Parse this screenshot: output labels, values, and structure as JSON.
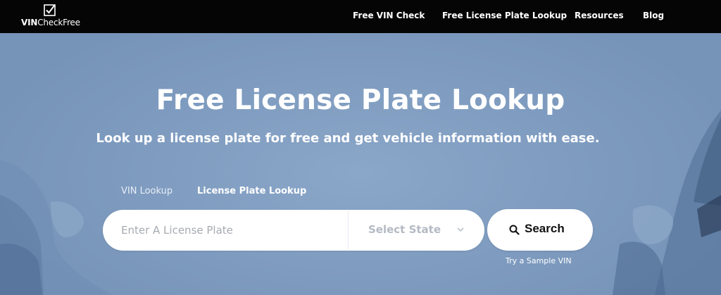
{
  "navbar": {
    "logo": {
      "bold": "VIN",
      "regular": "CheckFree",
      "icon": "checkbox-icon"
    },
    "items": [
      {
        "label": "Free VIN Check"
      },
      {
        "label": "Free License Plate Lookup"
      },
      {
        "label": "Resources"
      },
      {
        "label": "Blog"
      }
    ]
  },
  "hero": {
    "title": "Free License Plate Lookup",
    "subtitle": "Look up a license plate for free and get vehicle information with ease.",
    "tabs": [
      {
        "label": "VIN Lookup",
        "active": false
      },
      {
        "label": "License Plate Lookup",
        "active": true
      }
    ],
    "search": {
      "placeholder": "Enter A License Plate",
      "value": "",
      "state_select": {
        "selected": "Select State",
        "icon": "chevron-down-icon"
      },
      "button": {
        "label": "Search",
        "icon": "search-icon"
      }
    },
    "sample_link": "Try a Sample VIN"
  },
  "colors": {
    "navbar_bg": "#050505",
    "hero_bg": "#7e9bbf",
    "button_bg": "#ffffff",
    "text_on_hero": "#ffffff"
  }
}
